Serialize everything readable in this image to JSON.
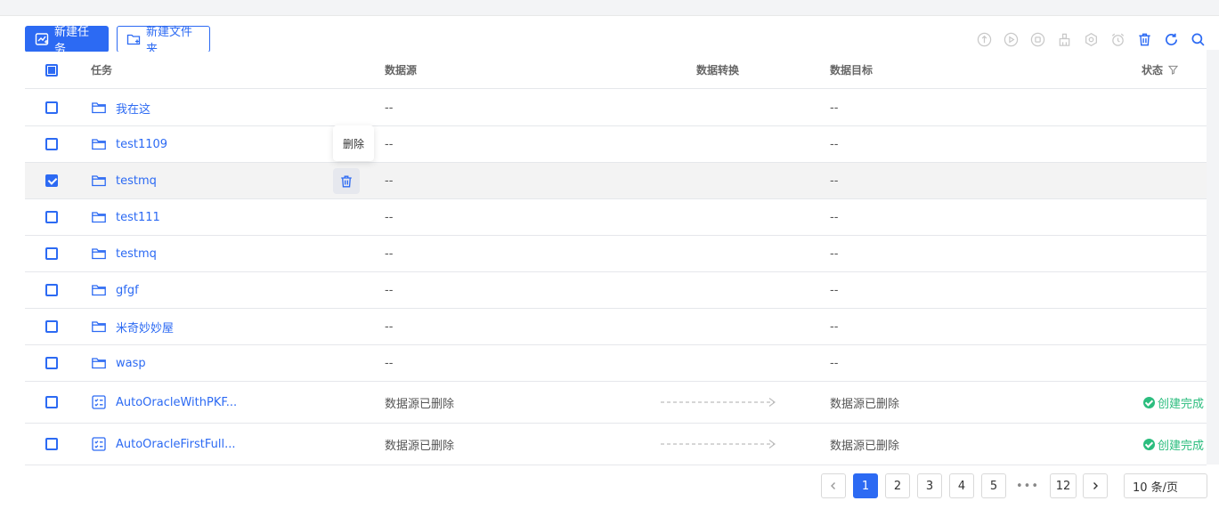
{
  "actions": {
    "new_task": "新建任务",
    "new_folder": "新建文件夹"
  },
  "toolbar_icons": [
    "start-circle-icon",
    "play-circle-icon",
    "stop-circle-icon",
    "broom-icon",
    "settings-gear-icon",
    "alarm-clock-icon",
    "trash-icon",
    "refresh-icon",
    "search-icon"
  ],
  "columns": {
    "task": "任务",
    "source": "数据源",
    "transform": "数据转换",
    "target": "数据目标",
    "status": "状态"
  },
  "rows": [
    {
      "type": "folder",
      "name": "我在这",
      "source": "--",
      "target": "--",
      "checked": false
    },
    {
      "type": "folder",
      "name": "test1109",
      "source": "--",
      "target": "--",
      "checked": false
    },
    {
      "type": "folder",
      "name": "testmq",
      "source": "--",
      "target": "--",
      "checked": true
    },
    {
      "type": "folder",
      "name": "test111",
      "source": "--",
      "target": "--",
      "checked": false
    },
    {
      "type": "folder",
      "name": "testmq",
      "source": "--",
      "target": "--",
      "checked": false
    },
    {
      "type": "folder",
      "name": "gfgf",
      "source": "--",
      "target": "--",
      "checked": false
    },
    {
      "type": "folder",
      "name": "米奇妙妙屋",
      "source": "--",
      "target": "--",
      "checked": false
    },
    {
      "type": "folder",
      "name": "wasp",
      "source": "--",
      "target": "--",
      "checked": false
    },
    {
      "type": "task",
      "name": "AutoOracleWithPKF...",
      "source": "数据源已删除",
      "target": "数据源已删除",
      "status": "创建完成",
      "checked": false
    },
    {
      "type": "task",
      "name": "AutoOracleFirstFull...",
      "source": "数据源已删除",
      "target": "数据源已删除",
      "status": "创建完成",
      "checked": false
    }
  ],
  "tooltip": "删除",
  "pagination": {
    "pages": [
      "1",
      "2",
      "3",
      "4",
      "5"
    ],
    "ellipsis": "•••",
    "last": "12",
    "current": "1",
    "page_size": "10 条/页"
  },
  "colors": {
    "primary": "#2c6af3",
    "success": "#2bbd7e",
    "row_selected": "#f3f3f3"
  }
}
